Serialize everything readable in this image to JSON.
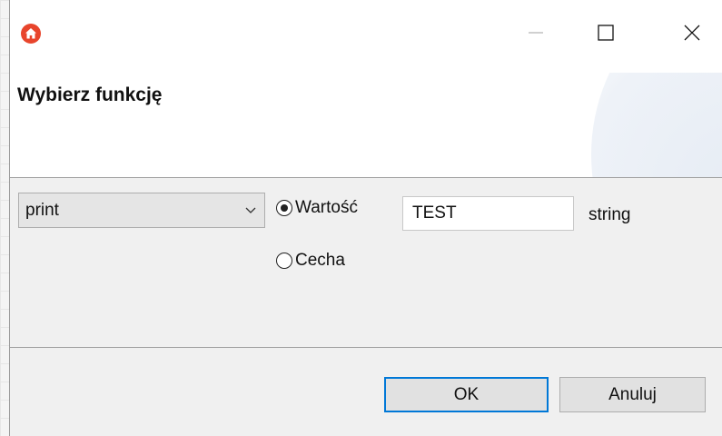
{
  "window": {
    "minimize_symbol": "—",
    "maximize_symbol": "☐",
    "close_symbol": "✕"
  },
  "header": {
    "title": "Wybierz funkcję"
  },
  "form": {
    "function_select": {
      "selected": "print"
    },
    "radio_value": {
      "label": "Wartość",
      "checked": true
    },
    "radio_trait": {
      "label": "Cecha",
      "checked": false
    },
    "value_input": {
      "value": "TEST"
    },
    "type_label": "string"
  },
  "footer": {
    "ok_label": "OK",
    "cancel_label": "Anuluj"
  },
  "colors": {
    "app_icon": "#e8452c",
    "focus_border": "#0078d7"
  }
}
